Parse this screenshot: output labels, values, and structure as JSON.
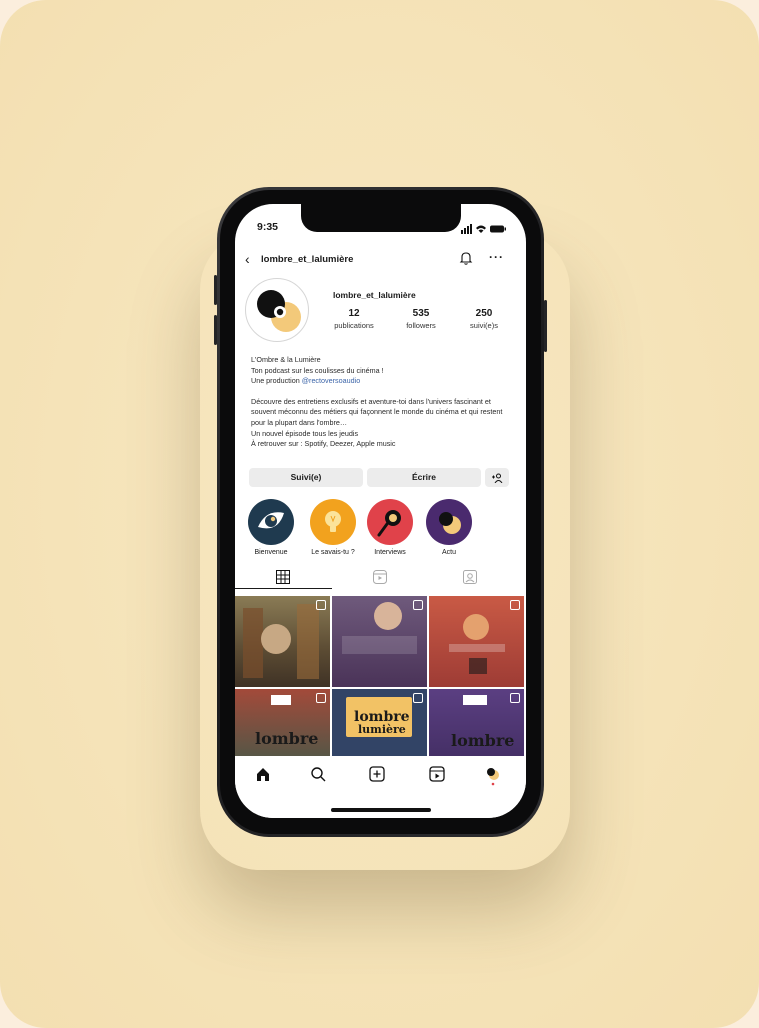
{
  "status_bar": {
    "time": "9:35"
  },
  "header": {
    "back_icon": "chevron-left-icon",
    "username": "lombre_et_lalumière",
    "notification_icon": "bell-icon",
    "more_icon": "more-icon"
  },
  "profile": {
    "name": "lombre_et_lalumière",
    "stats": [
      {
        "value": "12",
        "label": "publications"
      },
      {
        "value": "535",
        "label": "followers"
      },
      {
        "value": "250",
        "label": "suivi(e)s"
      }
    ]
  },
  "bio": {
    "display_name": "L'Ombre & la Lumière",
    "tagline": "Ton podcast sur les coulisses du cinéma !",
    "production_prefix": "Une production ",
    "production_link": "@rectoversoaudio",
    "description": "Découvre des entretiens exclusifs et aventure-toi dans l'univers fascinant et souvent méconnu des métiers qui façonnent le monde du cinéma et qui restent pour la plupart dans l'ombre…",
    "schedule": "Un nouvel épisode tous les jeudis",
    "platforms": "À retrouver sur : Spotify, Deezer, Apple music"
  },
  "actions": {
    "follow_label": "Suivi(e)",
    "message_label": "Écrire",
    "suggest_icon": "add-person-icon"
  },
  "highlights": [
    {
      "label": "Bienvenue",
      "color": "#1f3a4f"
    },
    {
      "label": "Le savais-tu ?",
      "color": "#f2a21e"
    },
    {
      "label": "Interviews",
      "color": "#e0424a"
    },
    {
      "label": "Actu",
      "color": "#4a2a6e"
    }
  ],
  "tabs": [
    {
      "icon": "grid-icon"
    },
    {
      "icon": "reels-icon"
    },
    {
      "icon": "tagged-icon"
    }
  ],
  "posts": [
    {
      "bg": "#6b5a3e"
    },
    {
      "bg": "#5a3f6a"
    },
    {
      "bg": "#b84a40"
    },
    {
      "bg": "#7a3a30"
    },
    {
      "bg": "#3a4a72"
    },
    {
      "bg": "#4a3370"
    }
  ],
  "bottom_nav": [
    {
      "icon": "home-icon"
    },
    {
      "icon": "search-icon"
    },
    {
      "icon": "new-post-icon"
    },
    {
      "icon": "reels-icon"
    },
    {
      "icon": "profile-icon"
    }
  ],
  "colors": {
    "accent_link": "#3b64a8",
    "background": "#f5e3b8"
  }
}
